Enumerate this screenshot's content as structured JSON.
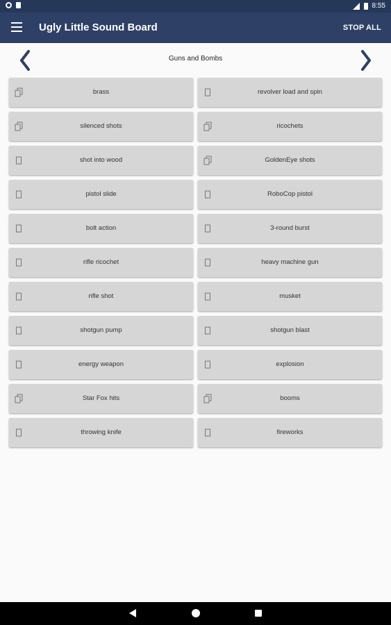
{
  "status_bar": {
    "time": "8:55"
  },
  "app_bar": {
    "title": "Ugly Little Sound Board",
    "stop_all_label": "STOP ALL"
  },
  "category": {
    "title": "Guns and Bombs"
  },
  "colors": {
    "app_bar": "#2f4066",
    "status_bar": "#26385a",
    "button_bg": "#d6d6d6",
    "page_bg": "#fafafa"
  },
  "sounds": [
    {
      "label": "brass",
      "icon": "multi-file-icon"
    },
    {
      "label": "revolver load and spin",
      "icon": "file-icon"
    },
    {
      "label": "silenced shots",
      "icon": "multi-file-icon"
    },
    {
      "label": "ricochets",
      "icon": "multi-file-icon"
    },
    {
      "label": "shot into wood",
      "icon": "file-icon"
    },
    {
      "label": "GoldenEye shots",
      "icon": "multi-file-icon"
    },
    {
      "label": "pistol slide",
      "icon": "file-icon"
    },
    {
      "label": "RoboCop pistol",
      "icon": "file-icon"
    },
    {
      "label": "bolt action",
      "icon": "file-icon"
    },
    {
      "label": "3-round burst",
      "icon": "file-icon"
    },
    {
      "label": "rifle ricochet",
      "icon": "file-icon"
    },
    {
      "label": "heavy machine gun",
      "icon": "file-icon"
    },
    {
      "label": "rifle shot",
      "icon": "file-icon"
    },
    {
      "label": "musket",
      "icon": "file-icon"
    },
    {
      "label": "shotgun pump",
      "icon": "file-icon"
    },
    {
      "label": "shotgun blast",
      "icon": "file-icon"
    },
    {
      "label": "energy weapon",
      "icon": "file-icon"
    },
    {
      "label": "explosion",
      "icon": "file-icon"
    },
    {
      "label": "Star Fox hits",
      "icon": "multi-file-icon"
    },
    {
      "label": "booms",
      "icon": "multi-file-icon"
    },
    {
      "label": "throwing knife",
      "icon": "file-icon"
    },
    {
      "label": "fireworks",
      "icon": "file-icon"
    }
  ]
}
